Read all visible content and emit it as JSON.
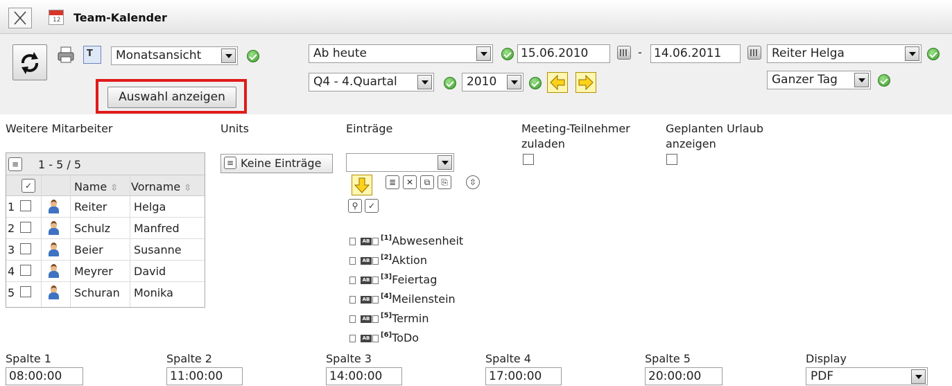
{
  "window": {
    "title": "Team-Kalender"
  },
  "toolbar": {
    "view_select": "Monatsansicht",
    "show_selection_button": "Auswahl anzeigen",
    "highlight_color": "#e01b1b"
  },
  "range": {
    "period_select": "Ab heute",
    "date_from": "15.06.2010",
    "separator": "-",
    "date_to": "14.06.2011",
    "quarter_select": "Q4 - 4.Quartal",
    "year_select": "2010",
    "person_select": "Reiter Helga",
    "duration_select": "Ganzer Tag"
  },
  "sections": {
    "employees_label": "Weitere Mitarbeiter",
    "units_label": "Units",
    "entries_label": "Einträge",
    "meeting_label_1": "Meeting-Teilnehmer",
    "meeting_label_2": "zuladen",
    "vacation_label_1": "Geplanten Urlaub",
    "vacation_label_2": "anzeigen"
  },
  "employees_grid": {
    "paging": "1 - 5 / 5",
    "col_name": "Name",
    "col_firstname": "Vorname",
    "rows": [
      {
        "num": "1",
        "name": "Reiter",
        "firstname": "Helga"
      },
      {
        "num": "2",
        "name": "Schulz",
        "firstname": "Manfred"
      },
      {
        "num": "3",
        "name": "Beier",
        "firstname": "Susanne"
      },
      {
        "num": "4",
        "name": "Meyrer",
        "firstname": "David"
      },
      {
        "num": "5",
        "name": "Schuran",
        "firstname": "Monika"
      }
    ]
  },
  "units": {
    "button": "Keine Einträge"
  },
  "entries": {
    "select_value": "",
    "types": [
      {
        "num": "[1]",
        "label": "Abwesenheit"
      },
      {
        "num": "[2]",
        "label": "Aktion"
      },
      {
        "num": "[3]",
        "label": "Feiertag"
      },
      {
        "num": "[4]",
        "label": "Meilenstein"
      },
      {
        "num": "[5]",
        "label": "Termin"
      },
      {
        "num": "[6]",
        "label": "ToDo"
      }
    ]
  },
  "columns": {
    "col1_label": "Spalte 1",
    "col1_value": "08:00:00",
    "col2_label": "Spalte 2",
    "col2_value": "11:00:00",
    "col3_label": "Spalte 3",
    "col3_value": "14:00:00",
    "col4_label": "Spalte 4",
    "col4_value": "17:00:00",
    "col5_label": "Spalte 5",
    "col5_value": "20:00:00",
    "display_label": "Display",
    "display_value": "PDF"
  }
}
